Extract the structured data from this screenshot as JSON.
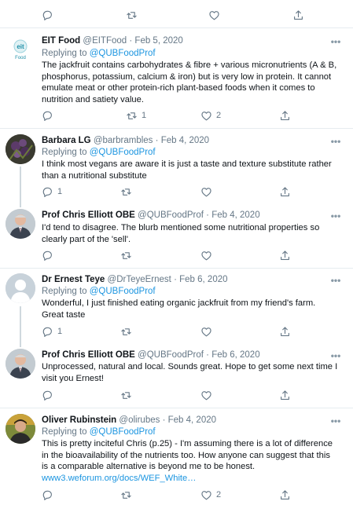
{
  "tweets": [
    {
      "name": "EIT Food",
      "handle": "@EITFood",
      "date": "Feb 5, 2020",
      "reply_prefix": "Replying to ",
      "reply_to": "@QUBFoodProf",
      "text": "The jackfruit contains carbohydrates & fibre + various micronutrients (A & B, phosphorus, potassium, calcium & iron) but is very low in protein. It cannot emulate meat or other protein-rich plant-based foods when it comes to nutrition and satiety value.",
      "replies": "",
      "retweets": "1",
      "likes": "2",
      "avatar_text": "Food"
    },
    {
      "name": "Barbara LG",
      "handle": "@barbrambles",
      "date": "Feb 4, 2020",
      "reply_prefix": "Replying to ",
      "reply_to": "@QUBFoodProf",
      "text": "I think most vegans are aware it is just a taste and texture substitute rather than a nutritional substitute",
      "replies": "1",
      "retweets": "",
      "likes": ""
    },
    {
      "name": "Prof Chris Elliott OBE",
      "handle": "@QUBFoodProf",
      "date": "Feb 4, 2020",
      "text": "I'd tend to disagree. The blurb mentioned some nutritional properties so clearly part of the 'sell'.",
      "replies": "",
      "retweets": "",
      "likes": ""
    },
    {
      "name": "Dr Ernest Teye",
      "handle": "@DrTeyeErnest",
      "date": "Feb 6, 2020",
      "reply_prefix": "Replying to ",
      "reply_to": "@QUBFoodProf",
      "text": "Wonderful, I just finished eating organic jackfruit from my friend's farm. Great taste",
      "replies": "1",
      "retweets": "",
      "likes": ""
    },
    {
      "name": "Prof Chris Elliott OBE",
      "handle": "@QUBFoodProf",
      "date": "Feb 6, 2020",
      "text": "Unprocessed, natural and local. Sounds great. Hope to get some next time I visit you Ernest!",
      "replies": "",
      "retweets": "",
      "likes": ""
    },
    {
      "name": "Oliver Rubinstein",
      "handle": "@olirubes",
      "date": "Feb 4, 2020",
      "reply_prefix": "Replying to ",
      "reply_to": "@QUBFoodProf",
      "text": "This is pretty inciteful Chris (p.25) - I'm assuming there is a lot of difference in the bioavailability of the nutrients too. How anyone can suggest that this is a comparable alternative is beyond me to be honest.",
      "link": "www3.weforum.org/docs/WEF_White…",
      "replies": "",
      "retweets": "",
      "likes": "2"
    }
  ],
  "colors": {
    "secondary": "#657786",
    "link": "#1b95e0",
    "separator": "#e6ecf0",
    "thread_line": "#cfd9de"
  },
  "icons": [
    "reply-icon",
    "retweet-icon",
    "like-icon",
    "share-icon",
    "more-icon"
  ]
}
